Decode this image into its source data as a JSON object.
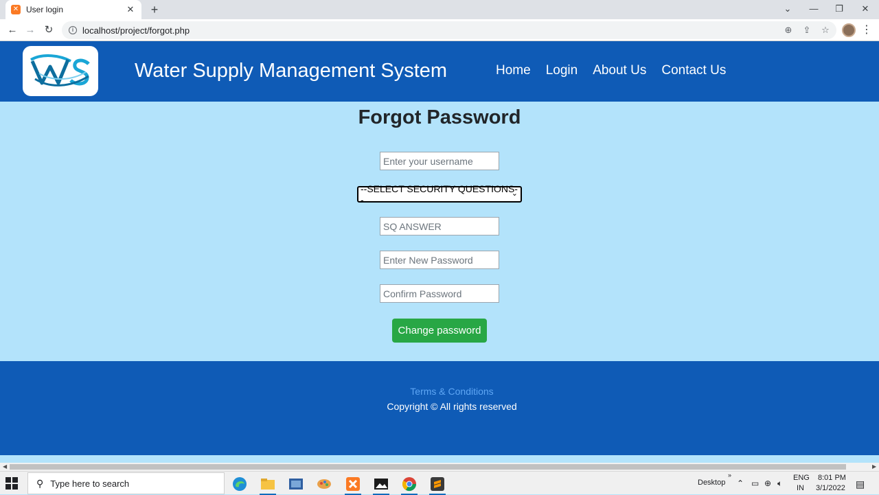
{
  "browser": {
    "tab_title": "User login",
    "tab_favicon": "xampp-icon",
    "url": "localhost/project/forgot.php",
    "new_tab_label": "+",
    "close_tab_label": "✕"
  },
  "site": {
    "title": "Water Supply Management System",
    "logo_icon": "ws-logo-icon",
    "nav": [
      "Home",
      "Login",
      "About Us",
      "Contact Us"
    ]
  },
  "form": {
    "heading": "Forgot Password",
    "username_placeholder": "Enter your username",
    "security_question_selected": "--SELECT SECURITY QUESTIONS--",
    "answer_placeholder": "SQ ANSWER",
    "new_password_placeholder": "Enter New Password",
    "confirm_password_placeholder": "Confirm Password",
    "submit_label": "Change password"
  },
  "footer": {
    "terms": "Terms & Conditions",
    "copyright": "Copyright © All rights reserved"
  },
  "taskbar": {
    "search_placeholder": "Type here to search",
    "desktop_label": "Desktop",
    "lang_top": "ENG",
    "lang_bottom": "IN",
    "time": "8:01 PM",
    "date": "3/1/2022"
  },
  "colors": {
    "header_bg": "#0f5bb6",
    "page_bg": "#b3e3fb",
    "button_bg": "#28a745",
    "link": "#5ea6f4"
  }
}
